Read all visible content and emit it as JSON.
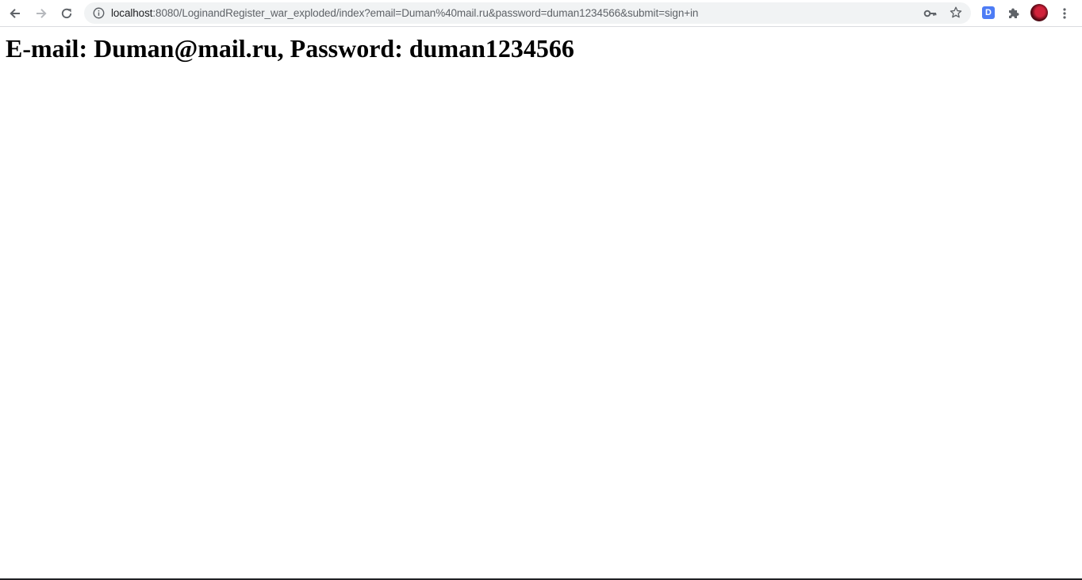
{
  "browser": {
    "url_host": "localhost",
    "url_rest": ":8080/LoginandRegister_war_exploded/index?email=Duman%40mail.ru&password=duman1234566&submit=sign+in",
    "extension_letter": "D",
    "icons": {
      "back": "arrow-left-icon",
      "forward": "arrow-right-icon",
      "reload": "reload-icon",
      "info": "info-icon",
      "key": "key-icon",
      "star": "star-icon",
      "puzzle": "puzzle-icon",
      "menu": "kebab-menu-icon"
    }
  },
  "page": {
    "heading": "E-mail: Duman@mail.ru, Password: duman1234566"
  },
  "colors": {
    "omnibox_bg": "#f1f3f4",
    "icon_gray": "#5f6368",
    "extension_blue": "#4d7cf5"
  }
}
